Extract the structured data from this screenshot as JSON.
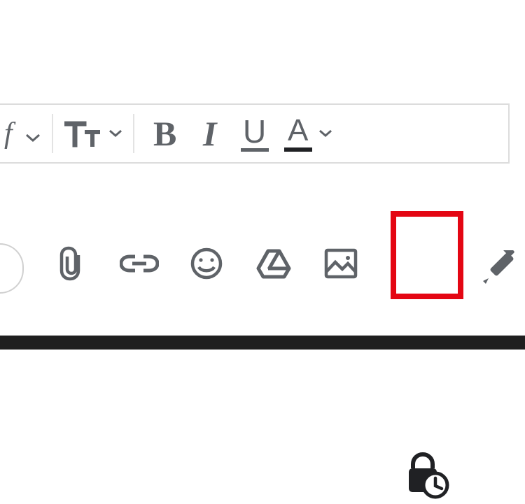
{
  "toolbar": {
    "font_label": "f",
    "bold_label": "B",
    "italic_label": "I",
    "underline_label": "U",
    "textcolor_label": "A"
  },
  "highlight": {
    "target": "confidential-mode-button"
  }
}
